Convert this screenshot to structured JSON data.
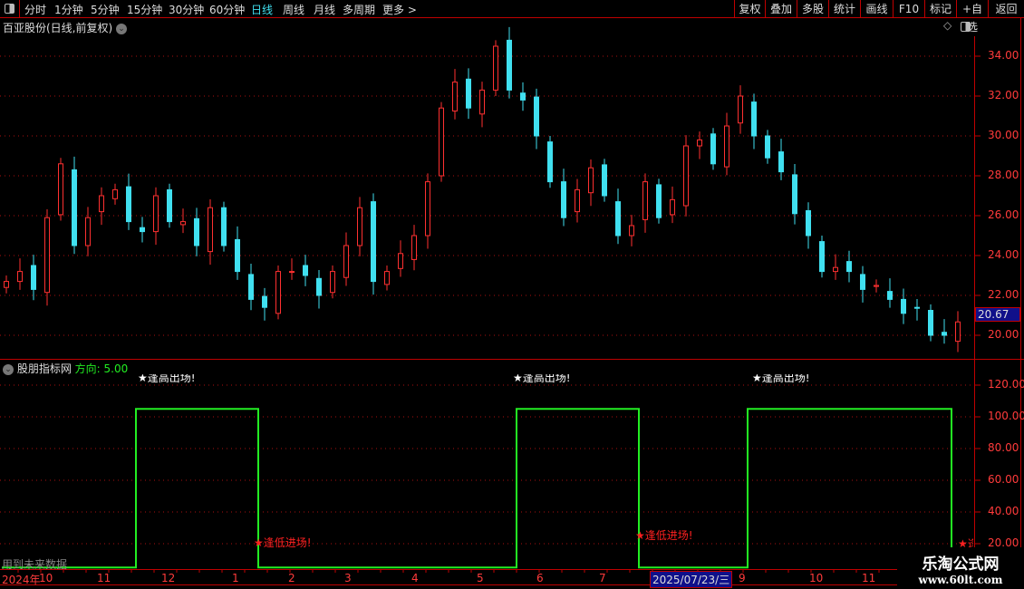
{
  "toolbar": {
    "periods": [
      "分时",
      "1分钟",
      "5分钟",
      "15分钟",
      "30分钟",
      "60分钟",
      "日线",
      "周线",
      "月线",
      "多周期",
      "更多 >"
    ],
    "active": "日线",
    "right": [
      "复权",
      "叠加",
      "多股",
      "统计",
      "画线",
      "F10",
      "标记",
      "+自选",
      "返回"
    ]
  },
  "main": {
    "title": "百亚股份(日线,前复权)",
    "last_price": "20.67",
    "y_labels": [
      "34.00",
      "32.00",
      "30.00",
      "28.00",
      "26.00",
      "24.00",
      "22.00",
      "20.00"
    ]
  },
  "indicator": {
    "name": "股朋指标网",
    "direction_label": "方向: 5.00",
    "y_labels": [
      "120.00",
      "100.00",
      "80.00",
      "60.00",
      "40.00",
      "20.00"
    ],
    "signal_high": "★逢高出场!",
    "signal_low": "★逢低进场!",
    "future_warning": "用到未来数据"
  },
  "date_axis": {
    "labels": [
      "2024年",
      "10",
      "11",
      "12",
      "1",
      "2",
      "3",
      "4",
      "5",
      "6",
      "7",
      "9",
      "10",
      "11"
    ],
    "cursor_date": "2025/07/23/三"
  },
  "watermark": {
    "name": "乐淘公式网",
    "url": "www.60lt.com"
  },
  "colors": {
    "up": "#ff3030",
    "down": "#40e0f0",
    "indicator_line": "#22ee22",
    "axis": "#c00000",
    "active_tab": "#40e0f0"
  },
  "chart_data": [
    {
      "type": "candlestick",
      "ylim": [
        19.5,
        35
      ],
      "last": 20.67,
      "closes": [
        22.7,
        23.2,
        22.3,
        25.9,
        28.6,
        24.5,
        25.9,
        27,
        27.3,
        25.7,
        25.2,
        27,
        25.7,
        25.7,
        24.5,
        26.4,
        24.5,
        23.2,
        21.8,
        21.4,
        23.2,
        23.2,
        23,
        22,
        23.2,
        24.5,
        26.4,
        22.7,
        23.2,
        24.1,
        25,
        27.7,
        31.4,
        32.7,
        31.4,
        32.3,
        34.5,
        32.3,
        31.8,
        30,
        27.7,
        25.9,
        27.3,
        28.4,
        27,
        25,
        25.5,
        27.7,
        25.9,
        26.8,
        29.5,
        29.8,
        28.6,
        30.5,
        32,
        30,
        28.9,
        28.2,
        26.1,
        25,
        23.2,
        23.4,
        23.2,
        22.3,
        22.5,
        21.8,
        21.1,
        21.4,
        20,
        20,
        20.67
      ]
    },
    {
      "type": "line",
      "ylim": [
        0,
        130
      ],
      "values": [
        5,
        5,
        5,
        5,
        5,
        5,
        5,
        5,
        5,
        5,
        105,
        105,
        105,
        105,
        105,
        105,
        105,
        105,
        105,
        5,
        5,
        5,
        5,
        5,
        5,
        5,
        5,
        5,
        5,
        5,
        5,
        5,
        5,
        5,
        5,
        5,
        5,
        5,
        105,
        105,
        105,
        105,
        105,
        105,
        105,
        105,
        105,
        5,
        5,
        5,
        5,
        5,
        5,
        5,
        5,
        105,
        105,
        105,
        105,
        105,
        105,
        105,
        105,
        105,
        105,
        105,
        105,
        105,
        105,
        105,
        5
      ]
    }
  ]
}
